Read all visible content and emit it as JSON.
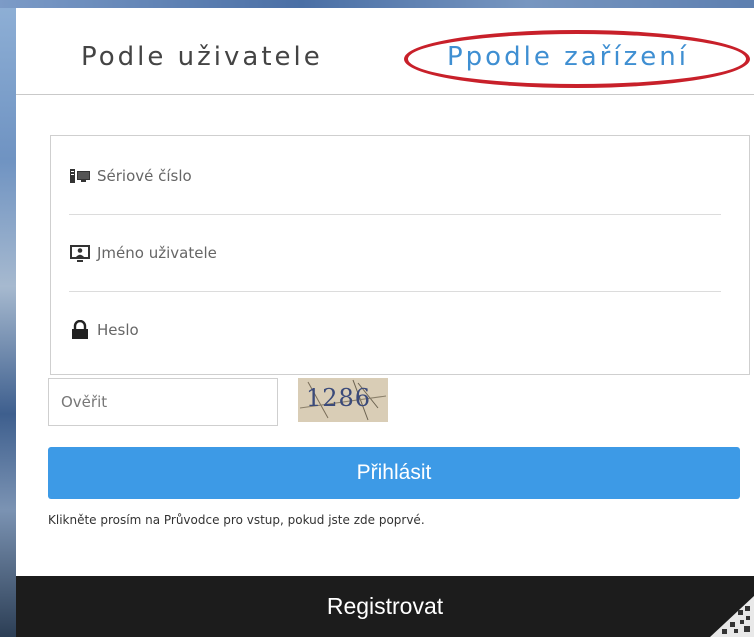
{
  "tabs": {
    "user": "Podle uživatele",
    "device": "Ppodle zařízení"
  },
  "fields": {
    "serial": "Sériové číslo",
    "username": "Jméno uživatele",
    "password": "Heslo"
  },
  "verify": {
    "placeholder": "Ověřit",
    "captcha": "1286"
  },
  "login_button": "Přihlásit",
  "hint": "Klikněte prosím na Průvodce pro vstup, pokud jste zde poprvé.",
  "register_button": "Registrovat",
  "colors": {
    "accent": "#3d9ae6",
    "tab_active": "#3f8fd2",
    "highlight_circle": "#c8202a",
    "register_bg": "#1c1c1c"
  },
  "icons": [
    "serial-device-icon",
    "user-monitor-icon",
    "lock-icon",
    "qr-code-icon"
  ]
}
